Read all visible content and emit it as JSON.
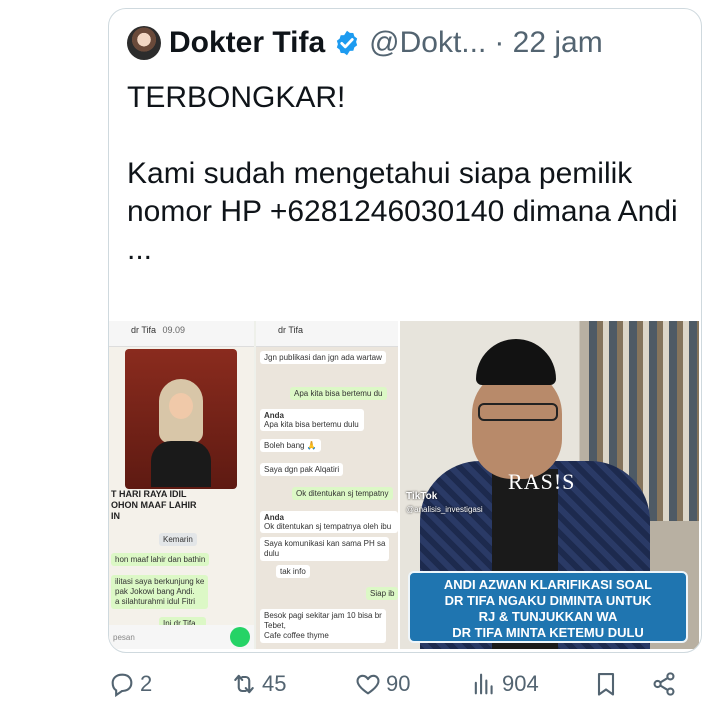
{
  "tweet": {
    "author_name": "Dokter Tifa",
    "handle": "@Dokt...",
    "time": "· 22 jam",
    "text_line1": "TERBONGKAR!",
    "text_line2": "Kami sudah mengetahui siapa pemilik nomor HP +6281246030140 dimana  Andi ..."
  },
  "media": {
    "left_screens": {
      "chat1": {
        "contact": "dr Tifa",
        "time": "09.09",
        "caption": "T HARI RAYA IDIL\nOHON MAAF LAHIR\nIN",
        "caption_time": "15.33",
        "msg1": "hon maaf lahir dan bathin",
        "msg1_time": "11.46",
        "msg2": "ilitasi saya berkunjung ke\npak Jokowi bang Andi.\na silahturahmi idul Fitri",
        "msg2_time": "12.11",
        "msg3": "Ini dr.Tifa...",
        "msg3_time": "12.29",
        "compose": "pesan",
        "date_label": "Kemarin"
      },
      "chat2": {
        "contact": "dr Tifa",
        "time": "09.09",
        "msg1": "Jgn publikasi dan jgn ada wartaw",
        "msg2": "Apa kita bisa bertemu du",
        "msg3_sender": "Anda",
        "msg3_quote": "Apa kita bisa bertemu dulu",
        "msg4": "Boleh bang 🙏",
        "msg4_time": "12.30",
        "msg5": "Saya dgn pak Alqatiri",
        "msg5_time": "12.31",
        "msg6": "Ok ditentukan sj tempatny",
        "msg7_sender": "Anda",
        "msg7_quote": "Ok ditentukan sj tempatnya oleh ibu",
        "msg8": "Saya komunikasi kan sama PH sa\ndulu",
        "msg9": "tak info",
        "msg10": "Siap ib",
        "msg11": "Besok pagi sekitar jam 10 bisa br\nTebet,\nCafe coffee thyme"
      }
    },
    "right_video": {
      "shirt_text": "RAS!S",
      "tiktok_label": "TikTok",
      "tiktok_handle": "@analisis_investigasi",
      "banner_lines": [
        "ANDI AZWAN KLARIFIKASI SOAL",
        "DR TIFA NGAKU DIMINTA UNTUK",
        "RJ & TUNJUKKAN WA",
        "DR TIFA MINTA KETEMU DULU"
      ]
    }
  },
  "actions": {
    "replies": "2",
    "retweets": "45",
    "likes": "90",
    "views": "904"
  },
  "colors": {
    "verified": "#1d9bf0",
    "text_secondary": "#536471",
    "border": "#cfd9de",
    "banner": "#1f75b0",
    "whatsapp_green": "#25d366"
  }
}
